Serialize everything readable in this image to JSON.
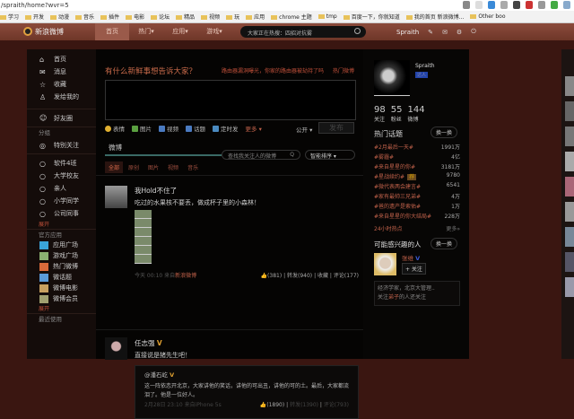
{
  "browser": {
    "url": "/spraith/home?wvr=5",
    "bookmarks": [
      "学习",
      "开发",
      "动漫",
      "音乐",
      "插件",
      "电影",
      "论坛",
      "精品",
      "视频",
      "玩",
      "应用",
      "chrome 主题",
      "tmp",
      "百度一下，你就知道",
      "我的首页 新浪微博...",
      "Other boo"
    ]
  },
  "nav": {
    "logo": "新浪微博",
    "tabs": [
      "首页",
      "热门▾",
      "应用▾",
      "游戏▾"
    ],
    "search_placeholder": "大家正在热搜：四招对抗雾",
    "user": "Spraith",
    "icons": [
      "✎",
      "✉",
      "⚙",
      "⏻"
    ]
  },
  "left": {
    "main": [
      {
        "icon": "⌂",
        "label": "首页"
      },
      {
        "icon": "✉",
        "label": "消息"
      },
      {
        "icon": "☆",
        "label": "收藏"
      },
      {
        "icon": "♙",
        "label": "发给我的"
      }
    ],
    "friends": {
      "icon": "☺",
      "label": "好友圈"
    },
    "group_title": "分组",
    "special": {
      "icon": "◎",
      "label": "特别关注"
    },
    "groups": [
      "软件4班",
      "大学校友",
      "亲人",
      "小学同学",
      "公司同事"
    ],
    "expand": "展开",
    "apps_title": "官方应用",
    "apps": [
      {
        "label": "应用广场",
        "color": "#3aa3d8"
      },
      {
        "label": "游戏广场",
        "color": "#8ab070"
      },
      {
        "label": "热门微博",
        "color": "#d86a3a"
      },
      {
        "label": "微话题",
        "color": "#5a9ad8"
      },
      {
        "label": "微博电影",
        "color": "#c8a060"
      },
      {
        "label": "微博会员",
        "color": "#a0a070"
      }
    ],
    "expand2": "展开",
    "recent_title": "最近使用"
  },
  "composer": {
    "prompt": "有什么新鲜事想告诉大家？",
    "hot_link": "路由器漏洞曝光，你家的路由器被劫持了吗",
    "hot_label": "热门微博",
    "tools": [
      {
        "label": "表情",
        "color": "#e0b030"
      },
      {
        "label": "图片",
        "color": "#5aa040"
      },
      {
        "label": "视频",
        "color": "#4a7ac0"
      },
      {
        "label": "话题",
        "color": "#4a7ac0"
      },
      {
        "label": "定时发",
        "color": "#4a8ac0"
      }
    ],
    "more": "更多 ▾",
    "visibility": "公开 ▾",
    "publish": "发布"
  },
  "feed": {
    "tab": "微博",
    "search_placeholder": "查找我关注人的微博",
    "sort": "智能排序 ▾",
    "filters": [
      "全部",
      "原创",
      "图片",
      "视频",
      "音乐"
    ],
    "posts": [
      {
        "author": "我Hold不住了",
        "text": "吃过的水果核不要丢，做成杯子里的小森林！",
        "time": "今天 00:10",
        "source_prefix": "来自",
        "source": "新浪微博",
        "likes": "(381)",
        "repost": "转发(940)",
        "fav": "收藏",
        "comment": "评论(177)"
      },
      {
        "author": "任志强",
        "text": "直接说是猪先生吧！",
        "quote_author": "@潘石屹",
        "quote_text": "这一阵依恋开北京，大家讲他的笑话，讲他的可出丑，讲他的可的土。最后，大家都流泪了。他是一位好人。",
        "quote_time": "2月28日 23:10",
        "quote_source_prefix": "来自",
        "quote_source": "iPhone 5s",
        "quote_likes": "(1890)",
        "quote_repost": "转发(1390)",
        "quote_comment": "评论(793)"
      }
    ]
  },
  "profile": {
    "name": "Spraith",
    "badge": "达人",
    "stats": [
      {
        "n": "98",
        "l": "关注"
      },
      {
        "n": "55",
        "l": "粉丝"
      },
      {
        "n": "144",
        "l": "微博"
      }
    ]
  },
  "hot": {
    "title": "热门话题",
    "refresh": "换一换",
    "items": [
      {
        "t": "#2月最后一天#",
        "n": "1991万"
      },
      {
        "t": "#雾霾#",
        "n": "4亿"
      },
      {
        "t": "#来自星星的你#",
        "n": "3181万"
      },
      {
        "t": "#星战续约#",
        "n": "9780",
        "tag": "荐"
      },
      {
        "t": "#微代表两会建言#",
        "n": "6541"
      },
      {
        "t": "#家有最帅三兄弟#",
        "n": "4万"
      },
      {
        "t": "#爸的遗产是索佑#",
        "n": "1万"
      },
      {
        "t": "#来自星星的你大结局#",
        "n": "228万"
      }
    ],
    "footer": "24小时热点",
    "footer_more": "更多»"
  },
  "suggest": {
    "title": "可能感兴趣的人",
    "refresh": "换一换",
    "name": "张维",
    "follow": "+ 关注",
    "desc1": "经济学家，北京大管理..",
    "desc2_pre": "关注",
    "desc2_hl": "弟子",
    "desc2_post": "的人还关注"
  }
}
